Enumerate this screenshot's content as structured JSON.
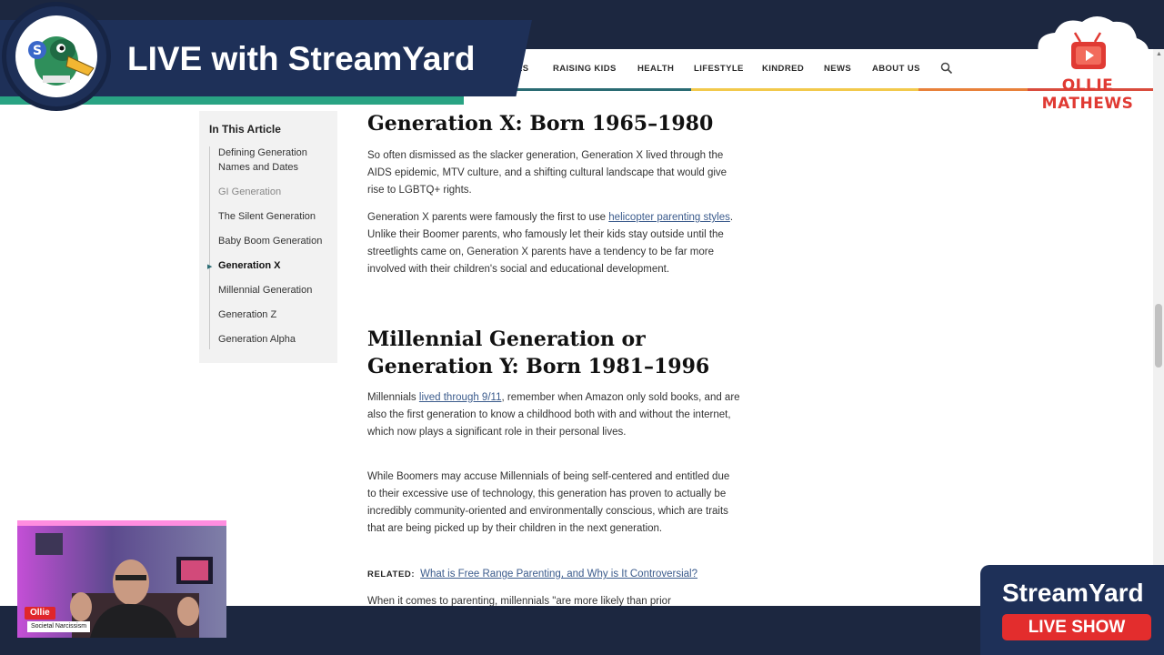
{
  "banner": {
    "title": "LIVE with StreamYard"
  },
  "site_nav": {
    "items": [
      "ES",
      "RAISING KIDS",
      "HEALTH",
      "LIFESTYLE",
      "KINDRED",
      "NEWS",
      "ABOUT US"
    ],
    "rainbow_colors": [
      "#2a6b73",
      "#f2c94c",
      "#e8813a",
      "#d94c3d"
    ]
  },
  "toc": {
    "title": "In This Article",
    "items": [
      "Defining Generation Names and Dates",
      "GI Generation",
      "The Silent Generation",
      "Baby Boom Generation",
      "Generation X",
      "Millennial Generation",
      "Generation Z",
      "Generation Alpha"
    ],
    "active_item": "Generation X"
  },
  "article": {
    "genx_heading": "Generation X: Born 1965–1980",
    "genx_p1": "So often dismissed as the slacker generation, Generation X lived through the AIDS epidemic, MTV culture, and a shifting cultural landscape that would give rise to LGBTQ+ rights.",
    "genx_p2_before": "Generation X parents were famously the first to use ",
    "genx_p2_link": "helicopter parenting styles",
    "genx_p2_after": ". Unlike their Boomer parents, who famously let their kids stay outside until the streetlights came on, Generation X parents have a tendency to be far more involved with their children's social and educational development.",
    "millennial_heading": "Millennial Generation or Generation Y: Born 1981–1996",
    "mill_p1_before": "Millennials ",
    "mill_p1_link": "lived through 9/11",
    "mill_p1_after": ", remember when Amazon only sold books, and are also the first generation to know a childhood both with and without the internet, which now plays a significant role in their personal lives.",
    "mill_p2": "While Boomers may accuse Millennials of being self-centered and entitled due to their excessive use of technology, this generation has proven to actually be incredibly community-oriented and environmentally conscious, which are traits that are being picked up by their children in the next generation.",
    "related_label": "RELATED:",
    "related_link": "What is Free Range Parenting, and Why is It Controversial?",
    "cut_line": "When it comes to parenting, millennials \"are more likely than prior"
  },
  "cloud_logo": {
    "text": "OLLIE MATHEWS",
    "color": "#e03a33"
  },
  "webcam": {
    "name": "Ollie",
    "subtitle": "Societal Narcissism"
  },
  "live_show": {
    "title": "StreamYard",
    "badge": "LIVE SHOW",
    "badge_color": "#e32d2d"
  },
  "icons": {
    "search": "search-icon",
    "logo": "duck-logo-icon",
    "tv": "tv-icon"
  }
}
